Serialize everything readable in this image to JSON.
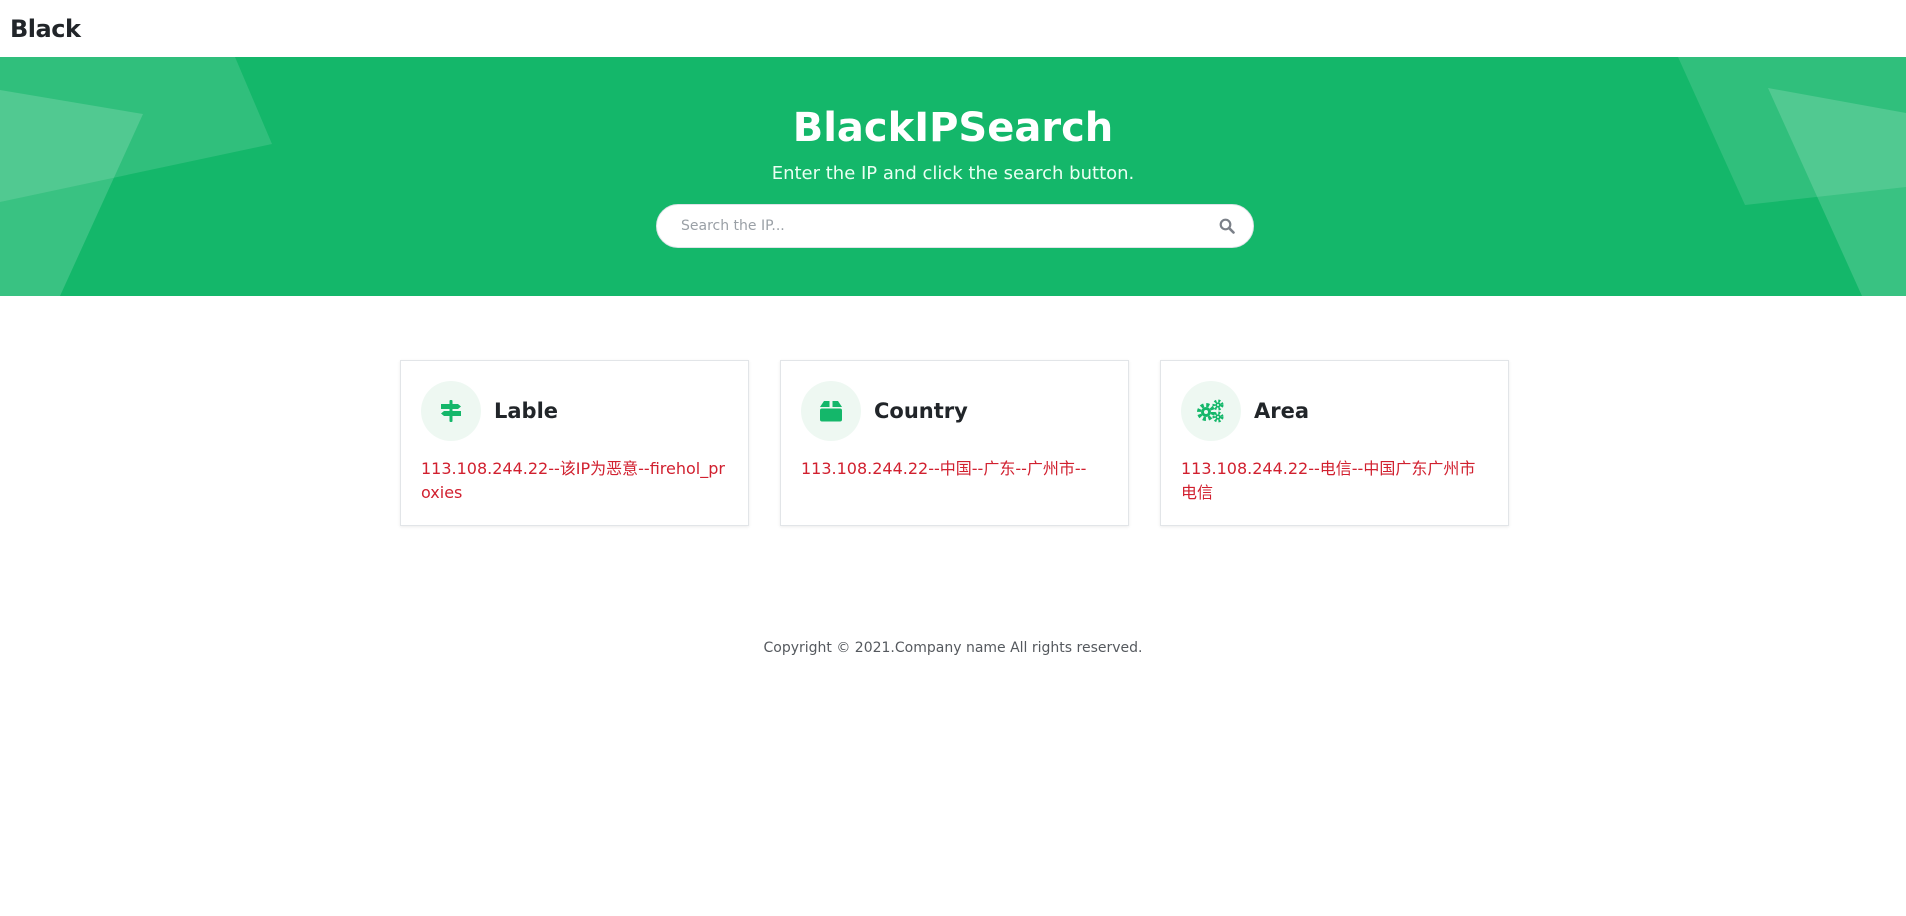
{
  "navbar": {
    "brand": "Black"
  },
  "hero": {
    "title": "BlackIPSearch",
    "subtitle": "Enter the IP and click the search button.",
    "search": {
      "placeholder": "Search the IP...",
      "value": ""
    }
  },
  "cards": [
    {
      "icon": "signpost-icon",
      "title": "Lable",
      "text": "113.108.244.22--该IP为恶意--firehol_proxies"
    },
    {
      "icon": "box-icon",
      "title": "Country",
      "text": "113.108.244.22--中国--广东--广州市--"
    },
    {
      "icon": "gears-icon",
      "title": "Area",
      "text": "113.108.244.22--电信--中国广东广州市电信"
    }
  ],
  "footer": {
    "copyright": "Copyright © 2021.Company name All rights reserved."
  },
  "colors": {
    "primary": "#14b76a",
    "danger": "#d1202f",
    "text": "#212529"
  }
}
